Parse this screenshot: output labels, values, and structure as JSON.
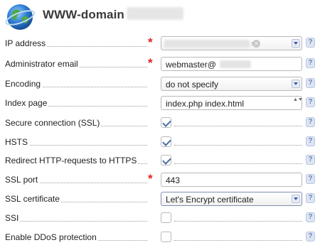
{
  "header": {
    "title": "WWW-domain -"
  },
  "icons": {
    "required": "*",
    "help": "?",
    "clear": "×",
    "stepper": "▲▼"
  },
  "form": {
    "ip_address": {
      "label": "IP address",
      "value": ""
    },
    "admin_email": {
      "label": "Administrator email",
      "value": "webmaster@"
    },
    "encoding": {
      "label": "Encoding",
      "value": "do not specify"
    },
    "index_page": {
      "label": "Index page",
      "value": "index.php index.html"
    },
    "ssl": {
      "label": "Secure connection (SSL)",
      "checked": true
    },
    "hsts": {
      "label": "HSTS",
      "checked": true
    },
    "redirect_https": {
      "label": "Redirect HTTP-requests to HTTPS",
      "checked": true
    },
    "ssl_port": {
      "label": "SSL port",
      "value": "443"
    },
    "ssl_certificate": {
      "label": "SSL certificate",
      "value": "Let's Encrypt certificate"
    },
    "ssi": {
      "label": "SSI",
      "checked": false
    },
    "ddos": {
      "label": "Enable DDoS protection",
      "checked": false
    }
  }
}
